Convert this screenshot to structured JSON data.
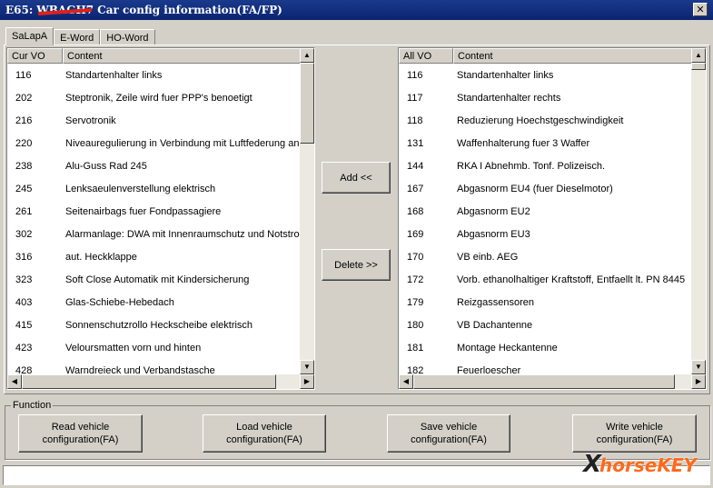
{
  "window": {
    "title_prefix": "E65:",
    "title_vin": "WBAGH7",
    "title_text": "Car config information(FA/FP)",
    "close_glyph": "✕"
  },
  "tabs": [
    {
      "label": "SaLapA",
      "active": true
    },
    {
      "label": "E-Word",
      "active": false
    },
    {
      "label": "HO-Word",
      "active": false
    }
  ],
  "left_list": {
    "headers": [
      "Cur VO",
      "Content"
    ],
    "rows": [
      {
        "code": "116",
        "content": "Standartenhalter links"
      },
      {
        "code": "202",
        "content": "Steptronik, Zeile wird fuer PPP's benoetigt"
      },
      {
        "code": "216",
        "content": "Servotronik"
      },
      {
        "code": "220",
        "content": "Niveauregulierung in Verbindung mit Luftfederung an"
      },
      {
        "code": "238",
        "content": "Alu-Guss Rad 245"
      },
      {
        "code": "245",
        "content": "Lenksaeulenverstellung elektrisch"
      },
      {
        "code": "261",
        "content": "Seitenairbags fuer Fondpassagiere"
      },
      {
        "code": "302",
        "content": "Alarmanlage: DWA mit Innenraumschutz und Notstrom"
      },
      {
        "code": "316",
        "content": "aut. Heckklappe"
      },
      {
        "code": "323",
        "content": "Soft Close Automatik mit Kindersicherung"
      },
      {
        "code": "403",
        "content": "Glas-Schiebe-Hebedach"
      },
      {
        "code": "415",
        "content": "Sonnenschutzrollo Heckscheibe elektrisch"
      },
      {
        "code": "423",
        "content": "Veloursmatten vorn und hinten"
      },
      {
        "code": "428",
        "content": "Warndreieck und Verbandstasche"
      }
    ]
  },
  "right_list": {
    "headers": [
      "All VO",
      "Content"
    ],
    "rows": [
      {
        "code": "116",
        "content": "Standartenhalter links"
      },
      {
        "code": "117",
        "content": "Standartenhalter rechts"
      },
      {
        "code": "118",
        "content": "Reduzierung Hoechstgeschwindigkeit"
      },
      {
        "code": "131",
        "content": "Waffenhalterung fuer 3 Waffer"
      },
      {
        "code": "144",
        "content": "RKA I Abnehmb. Tonf. Polizeisch."
      },
      {
        "code": "167",
        "content": "Abgasnorm EU4 (fuer Dieselmotor)"
      },
      {
        "code": "168",
        "content": "Abgasnorm EU2"
      },
      {
        "code": "169",
        "content": "Abgasnorm EU3"
      },
      {
        "code": "170",
        "content": "VB einb. AEG"
      },
      {
        "code": "172",
        "content": "Vorb. ethanolhaltiger Kraftstoff, Entfaellt lt. PN 8445"
      },
      {
        "code": "179",
        "content": "Reizgassensoren"
      },
      {
        "code": "180",
        "content": "VB Dachantenne"
      },
      {
        "code": "181",
        "content": "Montage Heckantenne"
      },
      {
        "code": "182",
        "content": "Feuerloescher"
      }
    ]
  },
  "buttons": {
    "add": "Add <<",
    "delete": "Delete >>"
  },
  "function_group": {
    "label": "Function",
    "read": "Read vehicle configuration(FA)",
    "load": "Load vehicle configuration(FA)",
    "save": "Save vehicle configuration(FA)",
    "write": "Write vehicle configuration(FA)"
  },
  "scroll_glyphs": {
    "up": "▲",
    "down": "▼",
    "left": "◀",
    "right": "▶"
  },
  "watermark": {
    "mark": "X",
    "text": "horseKEY"
  },
  "colors": {
    "title_bar": "#0b2470",
    "face": "#d4d0c8",
    "watermark": "#ff6a1a"
  }
}
